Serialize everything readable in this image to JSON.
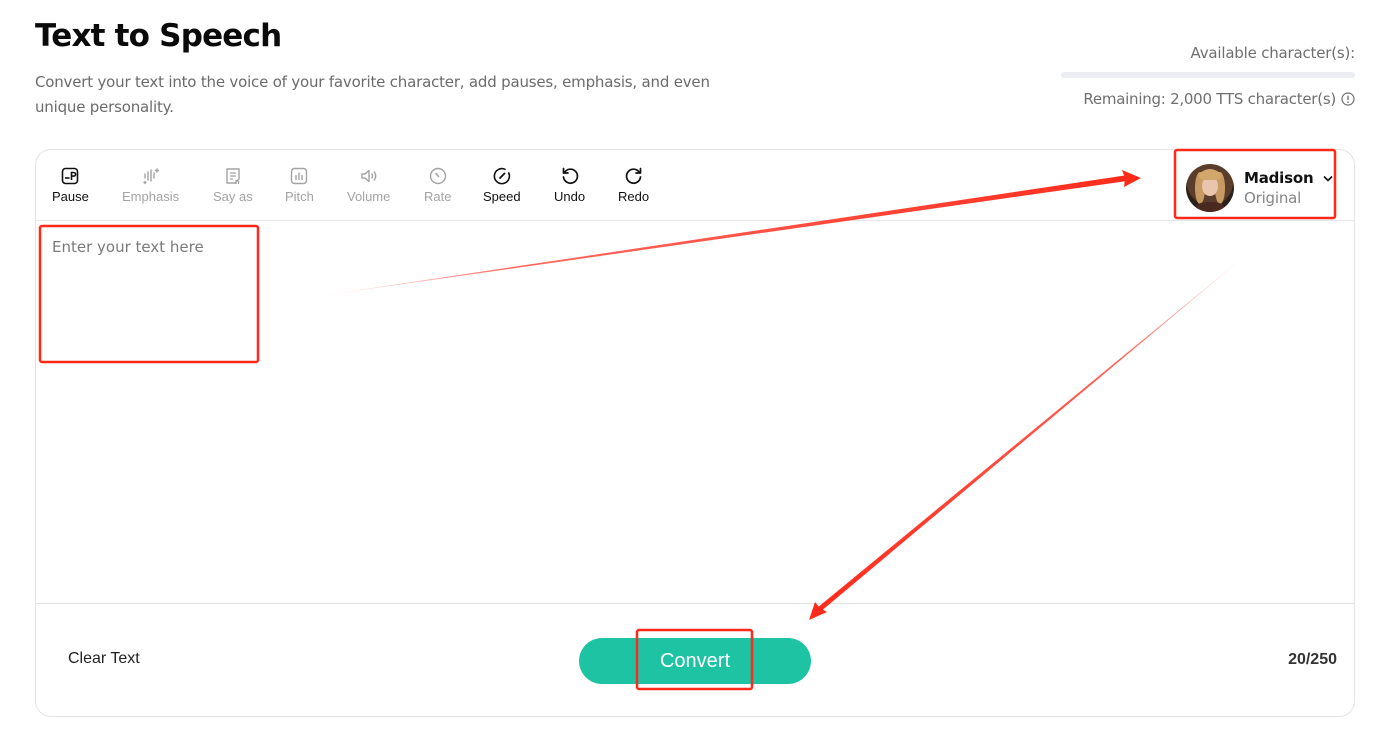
{
  "header": {
    "title": "Text to Speech",
    "description": "Convert your text into the voice of your favorite character, add pauses, emphasis, and even unique personality."
  },
  "quota": {
    "label": "Available character(s):",
    "remaining_text": "Remaining: 2,000 TTS character(s)",
    "used_fraction": 0,
    "info_icon": "info-circle-icon"
  },
  "toolbar": {
    "tools": [
      {
        "label": "Pause",
        "icon": "pause-marker-icon",
        "enabled": true
      },
      {
        "label": "Emphasis",
        "icon": "emphasis-wave-icon",
        "enabled": false
      },
      {
        "label": "Say as",
        "icon": "say-as-document-icon",
        "enabled": false
      },
      {
        "label": "Pitch",
        "icon": "pitch-bars-icon",
        "enabled": false
      },
      {
        "label": "Volume",
        "icon": "speaker-volume-icon",
        "enabled": false
      },
      {
        "label": "Rate",
        "icon": "rate-gauge-icon",
        "enabled": false
      },
      {
        "label": "Speed",
        "icon": "speedometer-icon",
        "enabled": true
      },
      {
        "label": "Undo",
        "icon": "undo-icon",
        "enabled": true
      },
      {
        "label": "Redo",
        "icon": "redo-icon",
        "enabled": true
      }
    ]
  },
  "voice": {
    "name": "Madison",
    "style": "Original",
    "avatar": "avatar-portrait"
  },
  "editor": {
    "placeholder": "Enter your text here",
    "value": ""
  },
  "footer": {
    "clear_label": "Clear Text",
    "convert_label": "Convert",
    "counter": "20/250"
  },
  "colors": {
    "accent": "#1ec3a4",
    "annotation": "#ff2a1a",
    "muted_text": "#6f6f6f",
    "disabled_tool": "#a3a3a3"
  }
}
